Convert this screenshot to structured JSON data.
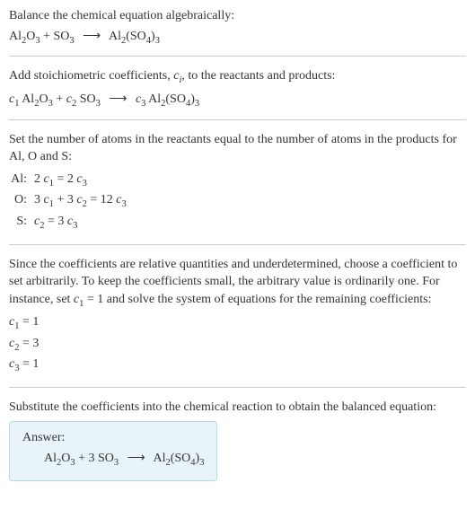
{
  "section1": {
    "title": "Balance the chemical equation algebraically:",
    "equation_html": "Al<sub>2</sub>O<sub>3</sub> + SO<sub>3</sub> <span class='arrow'>⟶</span> Al<sub>2</sub>(SO<sub>4</sub>)<sub>3</sub>"
  },
  "section2": {
    "title_html": "Add stoichiometric coefficients, <span class='italic'>c<sub>i</sub></span>, to the reactants and products:",
    "equation_html": "<span class='italic'>c</span><sub>1</sub> Al<sub>2</sub>O<sub>3</sub> + <span class='italic'>c</span><sub>2</sub> SO<sub>3</sub> <span class='arrow'>⟶</span> <span class='italic'>c</span><sub>3</sub> Al<sub>2</sub>(SO<sub>4</sub>)<sub>3</sub>"
  },
  "section3": {
    "title": "Set the number of atoms in the reactants equal to the number of atoms in the products for Al, O and S:",
    "rows": [
      {
        "label": "Al:",
        "eq_html": "2 <span class='italic'>c</span><sub>1</sub> = 2 <span class='italic'>c</span><sub>3</sub>"
      },
      {
        "label": "O:",
        "eq_html": "3 <span class='italic'>c</span><sub>1</sub> + 3 <span class='italic'>c</span><sub>2</sub> = 12 <span class='italic'>c</span><sub>3</sub>"
      },
      {
        "label": "S:",
        "eq_html": "<span class='italic'>c</span><sub>2</sub> = 3 <span class='italic'>c</span><sub>3</sub>"
      }
    ]
  },
  "section4": {
    "text_html": "Since the coefficients are relative quantities and underdetermined, choose a coefficient to set arbitrarily. To keep the coefficients small, the arbitrary value is ordinarily one. For instance, set <span class='italic'>c</span><sub>1</sub> = 1 and solve the system of equations for the remaining coefficients:",
    "coeffs": [
      {
        "html": "<span class='italic'>c</span><sub>1</sub> = 1"
      },
      {
        "html": "<span class='italic'>c</span><sub>2</sub> = 3"
      },
      {
        "html": "<span class='italic'>c</span><sub>3</sub> = 1"
      }
    ]
  },
  "section5": {
    "title": "Substitute the coefficients into the chemical reaction to obtain the balanced equation:",
    "answer_label": "Answer:",
    "answer_html": "Al<sub>2</sub>O<sub>3</sub> + 3 SO<sub>3</sub> <span class='arrow'>⟶</span> Al<sub>2</sub>(SO<sub>4</sub>)<sub>3</sub>"
  }
}
